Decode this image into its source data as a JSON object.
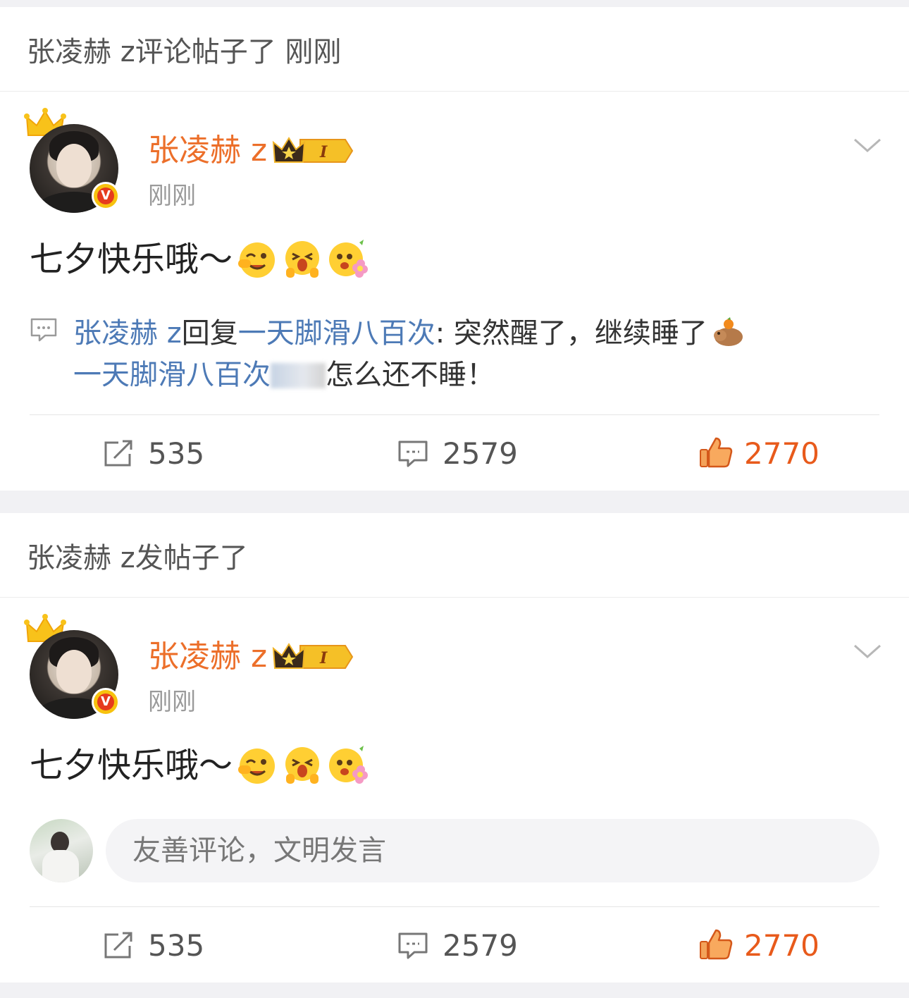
{
  "colors": {
    "username": "#ec6f2a",
    "link_blue": "#4d7ab6",
    "like_active": "#e85a1b",
    "muted": "#9a9a9a",
    "background": "#f1f1f4"
  },
  "feed": [
    {
      "header": "张凌赫 z评论帖子了 刚刚",
      "author": {
        "name": "张凌赫 z",
        "badge": "I",
        "verified": "V"
      },
      "time": "刚刚",
      "text": "七夕快乐哦～",
      "emojis": [
        "wink-emoji",
        "peace-emoji",
        "flower-emoji"
      ],
      "comment_preview": {
        "line1_author": "张凌赫 z",
        "line1_reply": "回复",
        "line1_target": "一天脚滑八百次",
        "line1_text": ": 突然醒了，继续睡了",
        "line2_author": "一天脚滑八百次",
        "line2_text": "怎么还不睡！"
      },
      "actions": {
        "reposts": "535",
        "comments": "2579",
        "likes": "2770"
      }
    },
    {
      "header": "张凌赫 z发帖子了",
      "author": {
        "name": "张凌赫 z",
        "badge": "I",
        "verified": "V"
      },
      "time": "刚刚",
      "text": "七夕快乐哦～",
      "emojis": [
        "wink-emoji",
        "peace-emoji",
        "flower-emoji"
      ],
      "comment_input": {
        "placeholder": "友善评论，文明发言"
      },
      "actions": {
        "reposts": "535",
        "comments": "2579",
        "likes": "2770"
      }
    }
  ]
}
